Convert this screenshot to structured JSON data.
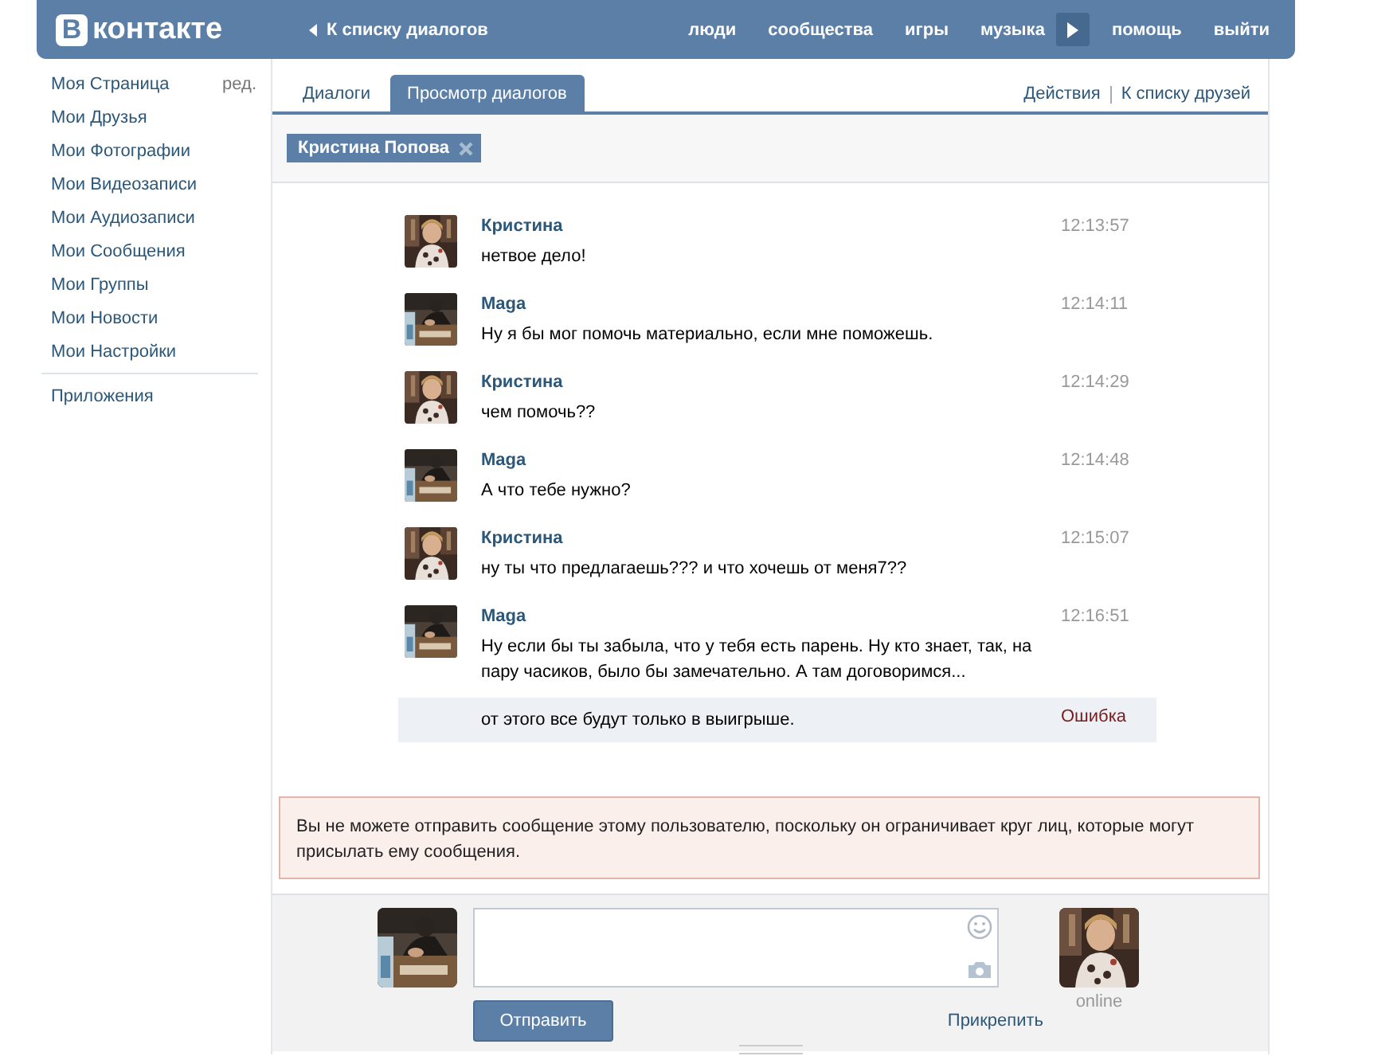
{
  "header": {
    "logo_mark": "В",
    "logo_text": "контакте",
    "back_link": "К списку диалогов",
    "nav": [
      {
        "kind": "link",
        "label": "люди"
      },
      {
        "kind": "link",
        "label": "сообщества"
      },
      {
        "kind": "link",
        "label": "игры"
      },
      {
        "kind": "link",
        "label": "музыка"
      },
      {
        "kind": "player"
      },
      {
        "kind": "link",
        "label": "помощь"
      },
      {
        "kind": "link",
        "label": "выйти"
      }
    ]
  },
  "sidebar": {
    "edit_link": "ред.",
    "items": [
      {
        "label": "Моя Страница"
      },
      {
        "label": "Мои Друзья"
      },
      {
        "label": "Мои Фотографии"
      },
      {
        "label": "Мои Видеозаписи"
      },
      {
        "label": "Мои Аудиозаписи"
      },
      {
        "label": "Мои Сообщения"
      },
      {
        "label": "Мои Группы"
      },
      {
        "label": "Мои Новости"
      },
      {
        "label": "Мои Настройки"
      }
    ],
    "extra_items": [
      {
        "label": "Приложения"
      }
    ]
  },
  "tabs": [
    {
      "label": "Диалоги",
      "selected": false
    },
    {
      "label": "Просмотр диалогов",
      "selected": true
    }
  ],
  "actions": [
    "Действия",
    "К списку друзей"
  ],
  "recipient_chip": {
    "label": "Кристина Попова"
  },
  "messages": [
    {
      "kind": "peer",
      "author": "Кристина",
      "time": "12:13:57",
      "text": "нетвое дело!",
      "failed": false
    },
    {
      "kind": "self",
      "author": "Maga",
      "time": "12:14:11",
      "text": "Ну я бы мог помочь материально, если мне поможешь.",
      "failed": false
    },
    {
      "kind": "peer",
      "author": "Кристина",
      "time": "12:14:29",
      "text": "чем помочь??",
      "failed": false
    },
    {
      "kind": "self",
      "author": "Maga",
      "time": "12:14:48",
      "text": "А что тебе нужно?",
      "failed": false
    },
    {
      "kind": "peer",
      "author": "Кристина",
      "time": "12:15:07",
      "text": "ну ты что предлагаешь??? и что хочешь от меня7??",
      "failed": false
    },
    {
      "kind": "self",
      "author": "Maga",
      "time": "12:16:51",
      "text": "Ну если бы ты забыла, что у тебя есть парень. Ну кто знает, так, на пару часиков, было бы замечательно. А там договоримся...",
      "failed": false
    },
    {
      "kind": "followup",
      "text": "от этого все будут только в выигрыше.",
      "failed": true,
      "status": "Ошибка"
    }
  ],
  "notice": "Вы не можете отправить сообщение этому пользователю, поскольку он ограничивает круг лиц, которые могут присылать ему сообщения.",
  "composer": {
    "send_button": "Отправить",
    "attach_link": "Прикрепить",
    "peer_status": "online"
  }
}
